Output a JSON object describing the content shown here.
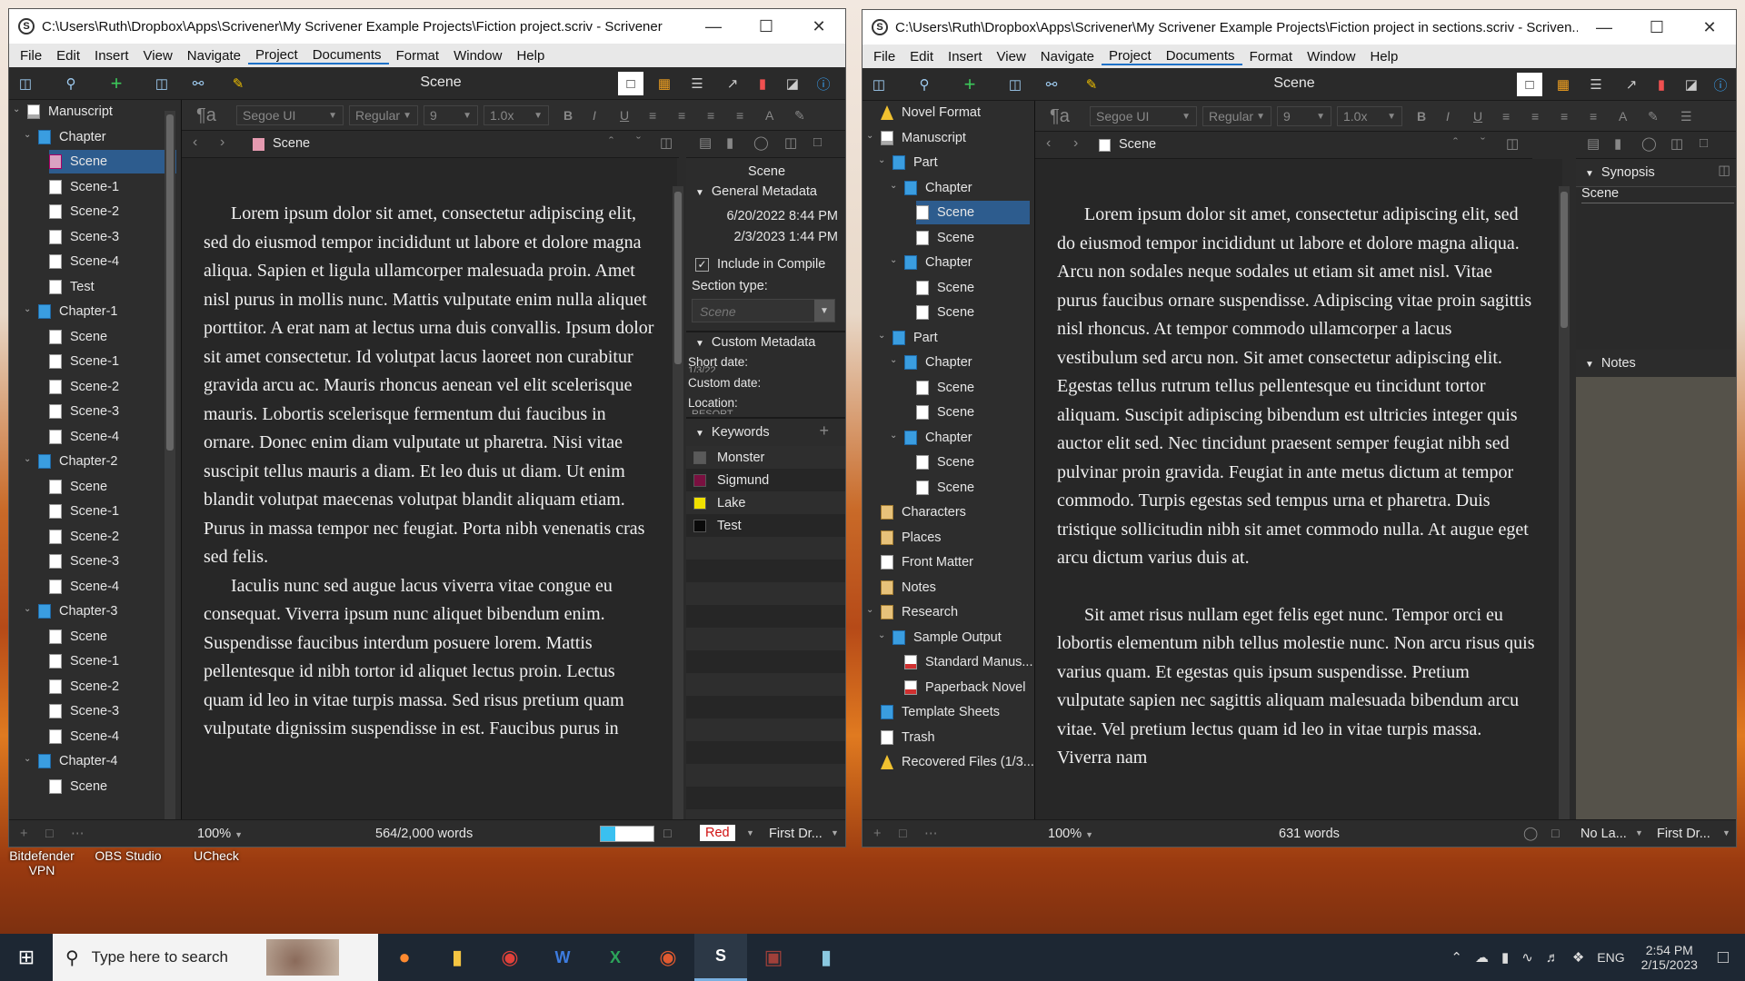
{
  "desktop": {
    "icons": [
      "Bitdefender VPN",
      "OBS Studio",
      "UCheck"
    ]
  },
  "left_window": {
    "title": "C:\\Users\\Ruth\\Dropbox\\Apps\\Scrivener\\My Scrivener Example Projects\\Fiction project.scriv - Scrivener",
    "menu": [
      "File",
      "Edit",
      "Insert",
      "View",
      "Navigate",
      "Project",
      "Documents",
      "Format",
      "Window",
      "Help"
    ],
    "toolbar_title": "Scene",
    "binder": [
      {
        "label": "Manuscript",
        "icon": "draft",
        "level": 0,
        "caret": "v"
      },
      {
        "label": "Chapter",
        "icon": "folder",
        "level": 1,
        "caret": "v"
      },
      {
        "label": "Scene",
        "icon": "pink",
        "level": 2,
        "selected": true
      },
      {
        "label": "Scene-1",
        "icon": "doc",
        "level": 2
      },
      {
        "label": "Scene-2",
        "icon": "doc",
        "level": 2
      },
      {
        "label": "Scene-3",
        "icon": "doc",
        "level": 2
      },
      {
        "label": "Scene-4",
        "icon": "doc",
        "level": 2
      },
      {
        "label": "Test",
        "icon": "doc",
        "level": 2
      },
      {
        "label": "Chapter-1",
        "icon": "folder",
        "level": 1,
        "caret": "v"
      },
      {
        "label": "Scene",
        "icon": "doc",
        "level": 2
      },
      {
        "label": "Scene-1",
        "icon": "doc",
        "level": 2
      },
      {
        "label": "Scene-2",
        "icon": "doc",
        "level": 2
      },
      {
        "label": "Scene-3",
        "icon": "doc",
        "level": 2
      },
      {
        "label": "Scene-4",
        "icon": "doc",
        "level": 2
      },
      {
        "label": "Chapter-2",
        "icon": "folder",
        "level": 1,
        "caret": "v"
      },
      {
        "label": "Scene",
        "icon": "doc",
        "level": 2
      },
      {
        "label": "Scene-1",
        "icon": "doc",
        "level": 2
      },
      {
        "label": "Scene-2",
        "icon": "doc",
        "level": 2
      },
      {
        "label": "Scene-3",
        "icon": "doc",
        "level": 2
      },
      {
        "label": "Scene-4",
        "icon": "doc",
        "level": 2
      },
      {
        "label": "Chapter-3",
        "icon": "folder",
        "level": 1,
        "caret": "v"
      },
      {
        "label": "Scene",
        "icon": "doc",
        "level": 2
      },
      {
        "label": "Scene-1",
        "icon": "doc",
        "level": 2
      },
      {
        "label": "Scene-2",
        "icon": "doc",
        "level": 2
      },
      {
        "label": "Scene-3",
        "icon": "doc",
        "level": 2
      },
      {
        "label": "Scene-4",
        "icon": "doc",
        "level": 2
      },
      {
        "label": "Chapter-4",
        "icon": "folder",
        "level": 1,
        "caret": "v"
      },
      {
        "label": "Scene",
        "icon": "doc",
        "level": 2
      }
    ],
    "format": {
      "font": "Segoe UI",
      "style": "Regular",
      "size": "9",
      "spacing": "1.0x"
    },
    "doc_header": "Scene",
    "paragraphs": [
      "Lorem ipsum dolor sit amet, consectetur adipiscing elit, sed do eiusmod tempor incididunt ut labore et dolore magna aliqua. Sapien et ligula ullamcorper malesuada proin. Amet nisl purus in mollis nunc. Mattis vulputate enim nulla aliquet porttitor. A erat nam at lectus urna duis convallis. Ipsum dolor sit amet consectetur. Id volutpat lacus laoreet non curabitur gravida arcu ac. Mauris rhoncus aenean vel elit scelerisque mauris. Lobortis scelerisque fermentum dui faucibus in ornare. Donec enim diam vulputate ut pharetra. Nisi vitae suscipit tellus mauris a diam. Et leo duis ut diam. Ut enim blandit volutpat maecenas volutpat blandit aliquam etiam. Purus in massa tempor nec feugiat. Porta nibh venenatis cras sed felis.",
      "Iaculis nunc sed augue lacus viverra vitae congue eu consequat. Viverra ipsum nunc aliquet bibendum enim. Suspendisse faucibus interdum posuere lorem. Mattis pellentesque id nibh tortor id aliquet lectus proin. Lectus quam id leo in vitae turpis massa. Sed risus pretium quam vulputate dignissim suspendisse in est. Faucibus purus in"
    ],
    "inspector": {
      "title": "Scene",
      "general_metadata": "General Metadata",
      "created": "6/20/2022 8:44 PM",
      "modified": "2/3/2023 1:44 PM",
      "include_in_compile": "Include in Compile",
      "section_type_label": "Section type:",
      "section_type_value": "Scene",
      "custom_metadata": "Custom Metadata",
      "short_date_label": "Short date:",
      "short_date_value": "1/3/22",
      "custom_date_label": "Custom date:",
      "location_label": "Location:",
      "location_value": "Resort",
      "keywords_label": "Keywords",
      "keywords": [
        {
          "name": "Monster",
          "color": "#5a5a5a"
        },
        {
          "name": "Sigmund",
          "color": "#7a1040"
        },
        {
          "name": "Lake",
          "color": "#f0e000"
        },
        {
          "name": "Test",
          "color": "#0a0a0a"
        }
      ]
    },
    "footer": {
      "zoom": "100%",
      "words": "564/2,000 words",
      "label": "Red",
      "status": "First Dr..."
    }
  },
  "right_window": {
    "title": "C:\\Users\\Ruth\\Dropbox\\Apps\\Scrivener\\My Scrivener Example Projects\\Fiction project in sections.scriv - Scriven...",
    "menu": [
      "File",
      "Edit",
      "Insert",
      "View",
      "Navigate",
      "Project",
      "Documents",
      "Format",
      "Window",
      "Help"
    ],
    "toolbar_title": "Scene",
    "binder": [
      {
        "label": "Novel Format",
        "icon": "warn",
        "level": 0
      },
      {
        "label": "Manuscript",
        "icon": "draft",
        "level": 0,
        "caret": "v"
      },
      {
        "label": "Part",
        "icon": "folder",
        "level": 1,
        "caret": "v"
      },
      {
        "label": "Chapter",
        "icon": "folder",
        "level": 2,
        "caret": "v"
      },
      {
        "label": "Scene",
        "icon": "doc",
        "level": 3,
        "selected": true
      },
      {
        "label": "Scene",
        "icon": "doc",
        "level": 3
      },
      {
        "label": "Chapter",
        "icon": "folder",
        "level": 2,
        "caret": "v"
      },
      {
        "label": "Scene",
        "icon": "doc",
        "level": 3
      },
      {
        "label": "Scene",
        "icon": "doc",
        "level": 3
      },
      {
        "label": "Part",
        "icon": "folder",
        "level": 1,
        "caret": "v"
      },
      {
        "label": "Chapter",
        "icon": "folder",
        "level": 2,
        "caret": "v"
      },
      {
        "label": "Scene",
        "icon": "doc",
        "level": 3
      },
      {
        "label": "Scene",
        "icon": "doc",
        "level": 3
      },
      {
        "label": "Chapter",
        "icon": "folder",
        "level": 2,
        "caret": "v"
      },
      {
        "label": "Scene",
        "icon": "doc",
        "level": 3
      },
      {
        "label": "Scene",
        "icon": "doc",
        "level": 3
      },
      {
        "label": "Characters",
        "icon": "special",
        "level": 0
      },
      {
        "label": "Places",
        "icon": "special",
        "level": 0
      },
      {
        "label": "Front Matter",
        "icon": "doc",
        "level": 0
      },
      {
        "label": "Notes",
        "icon": "special",
        "level": 0
      },
      {
        "label": "Research",
        "icon": "special",
        "level": 0,
        "caret": "v"
      },
      {
        "label": "Sample Output",
        "icon": "folder",
        "level": 1,
        "caret": "v"
      },
      {
        "label": "Standard Manus...",
        "icon": "pdf",
        "level": 2
      },
      {
        "label": "Paperback Novel",
        "icon": "pdf",
        "level": 2
      },
      {
        "label": "Template Sheets",
        "icon": "folder",
        "level": 0
      },
      {
        "label": "Trash",
        "icon": "trash",
        "level": 0
      },
      {
        "label": "Recovered Files (1/3...",
        "icon": "warn",
        "level": 0
      }
    ],
    "format": {
      "font": "Segoe UI",
      "style": "Regular",
      "size": "9",
      "spacing": "1.0x"
    },
    "doc_header": "Scene",
    "paragraphs": [
      "Lorem ipsum dolor sit amet, consectetur adipiscing elit, sed do eiusmod tempor incididunt ut labore et dolore magna aliqua. Arcu non sodales neque sodales ut etiam sit amet nisl. Vitae purus faucibus ornare suspendisse. Adipiscing vitae proin sagittis nisl rhoncus. At tempor commodo ullamcorper a lacus vestibulum sed arcu non. Sit amet consectetur adipiscing elit. Egestas tellus rutrum tellus pellentesque eu tincidunt tortor aliquam. Suscipit adipiscing bibendum est ultricies integer quis auctor elit sed. Nec tincidunt praesent semper feugiat nibh sed pulvinar proin gravida. Feugiat in ante metus dictum at tempor commodo. Turpis egestas sed tempus urna et pharetra. Duis tristique sollicitudin nibh sit amet commodo nulla. At augue eget arcu dictum varius duis at.",
      "Sit amet risus nullam eget felis eget nunc. Tempor orci eu lobortis elementum nibh tellus molestie nunc. Non arcu risus quis varius quam. Et egestas quis ipsum suspendisse. Pretium vulputate sapien nec sagittis aliquam malesuada bibendum arcu vitae. Vel pretium lectus quam id leo in vitae turpis massa. Viverra nam"
    ],
    "inspector": {
      "synopsis_label": "Synopsis",
      "synopsis_title": "Scene",
      "notes_label": "Notes"
    },
    "footer": {
      "zoom": "100%",
      "words": "631 words",
      "label": "No La...",
      "status": "First Dr..."
    }
  },
  "taskbar": {
    "search_placeholder": "Type here to search",
    "lang": "ENG",
    "time": "2:54 PM",
    "date": "2/15/2023"
  }
}
